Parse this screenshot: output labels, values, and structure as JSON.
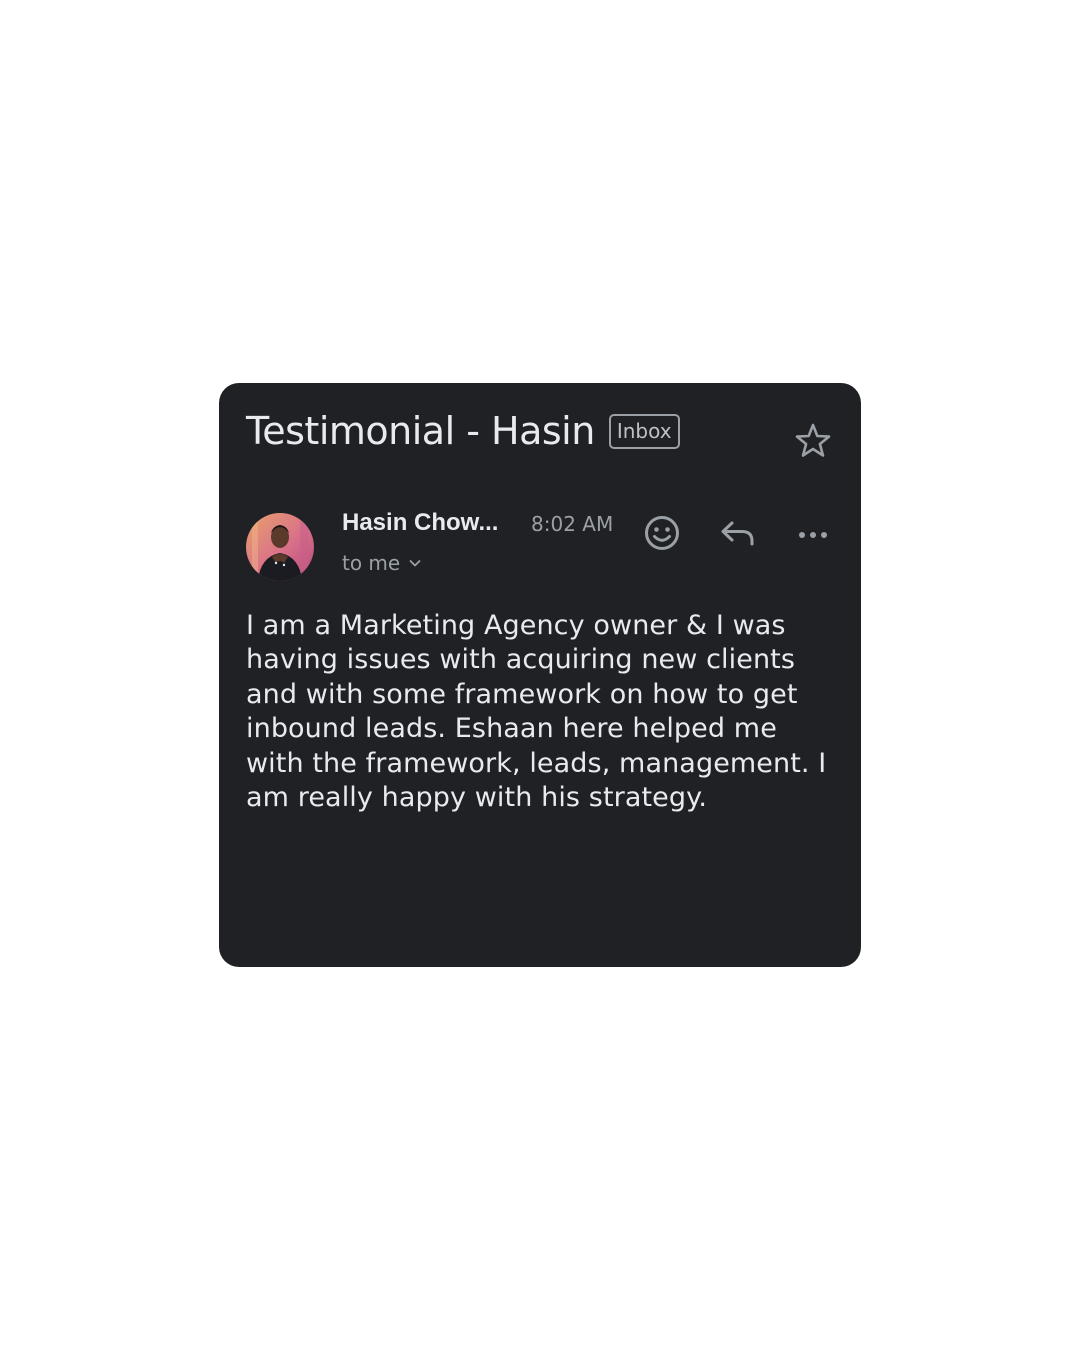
{
  "email": {
    "subject": "Testimonial - Hasin",
    "label": "Inbox",
    "sender": "Hasin Chow...",
    "time": "8:02 AM",
    "recipient": "to me",
    "body": "I am a Marketing Agency owner & I was having issues with acquiring new clients and with some framework on how to get inbound leads. Eshaan here helped me with the framework, leads, management. I am really happy with his strategy."
  },
  "icons": {
    "star": "star-icon",
    "emoji": "emoji-icon",
    "reply": "reply-icon",
    "more": "more-icon",
    "chevron": "chevron-down-icon"
  },
  "colors": {
    "card_background": "#202124",
    "text_primary": "#e8eaed",
    "text_secondary": "#9aa0a6",
    "page_background": "#ffffff"
  }
}
